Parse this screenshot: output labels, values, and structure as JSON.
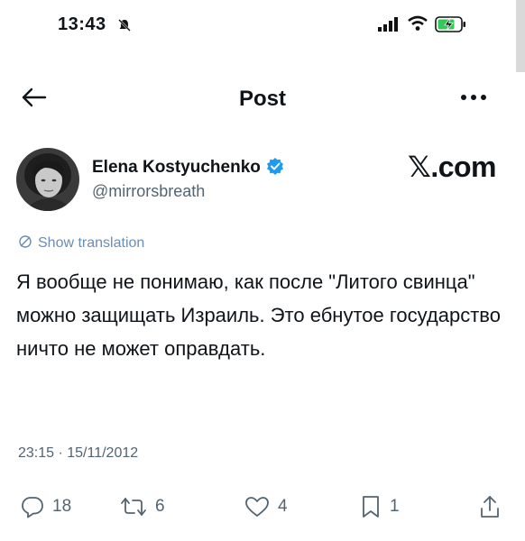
{
  "status_bar": {
    "time": "13:43",
    "icons": [
      "mute-bell-icon",
      "cellular-signal-icon",
      "wifi-icon",
      "battery-charging-icon"
    ]
  },
  "header": {
    "title": "Post",
    "back_icon": "back-arrow-icon",
    "more_icon": "more-icon"
  },
  "author": {
    "name": "Elena Kostyuchenko",
    "handle": "@mirrorsbreath",
    "verified": true,
    "verified_color": "#1d9bf0"
  },
  "watermark": {
    "x_glyph": "𝕏",
    "suffix": ".com"
  },
  "translation": {
    "label": "Show translation",
    "color": "#6b8db3"
  },
  "tweet": {
    "text": "Я вообще не понимаю, как после \"Литого свинца\" можно защищать Израиль. Это ебнутое государство ничто не может оправдать.",
    "timestamp": "23:15 · 15/11/2012"
  },
  "actions": {
    "replies": "18",
    "reposts": "6",
    "likes": "4",
    "bookmarks": "1"
  }
}
